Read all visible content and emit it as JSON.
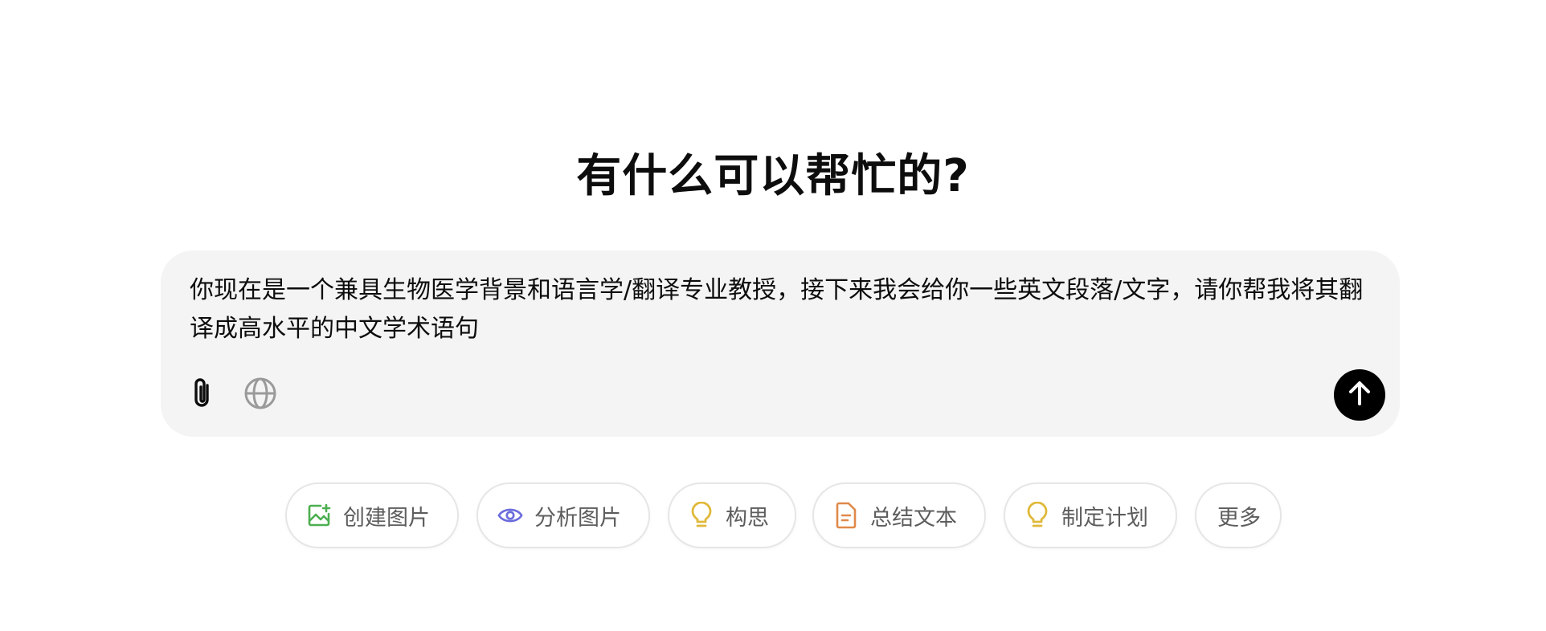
{
  "heading": "有什么可以帮忙的?",
  "composer": {
    "text": "你现在是一个兼具生物医学背景和语言学/翻译专业教授，接下来我会给你一些英文段落/文字，请你帮我将其翻译成高水平的中文学术语句",
    "attach_icon": "paperclip-icon",
    "web_icon": "globe-icon",
    "send_icon": "arrow-up-icon"
  },
  "chips": [
    {
      "label": "创建图片",
      "icon": "create-image-icon",
      "color": "#4caf50"
    },
    {
      "label": "分析图片",
      "icon": "eye-icon",
      "color": "#6b6bdc"
    },
    {
      "label": "构思",
      "icon": "lightbulb-icon",
      "color": "#e0b93a"
    },
    {
      "label": "总结文本",
      "icon": "document-icon",
      "color": "#e0894a"
    },
    {
      "label": "制定计划",
      "icon": "lightbulb-icon",
      "color": "#e0b93a"
    },
    {
      "label": "更多",
      "icon": "",
      "color": ""
    }
  ]
}
